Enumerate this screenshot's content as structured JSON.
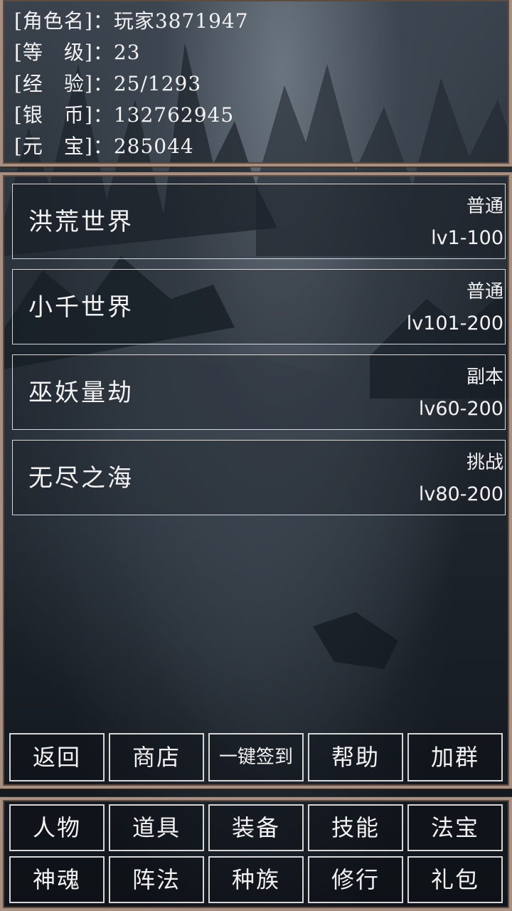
{
  "stats": [
    {
      "label": "[角色名]：",
      "value": "玩家3871947"
    },
    {
      "label": "[等　级]：",
      "value": "23"
    },
    {
      "label": "[经　验]：",
      "value": "25/1293"
    },
    {
      "label": "[银　币]：",
      "value": "132762945"
    },
    {
      "label": "[元　宝]：",
      "value": "285044"
    }
  ],
  "maps": [
    {
      "name": "洪荒世界",
      "type": "普通",
      "level": "lv1-100"
    },
    {
      "name": "小千世界",
      "type": "普通",
      "level": "lv101-200"
    },
    {
      "name": "巫妖量劫",
      "type": "副本",
      "level": "lv60-200"
    },
    {
      "name": "无尽之海",
      "type": "挑战",
      "level": "lv80-200"
    }
  ],
  "actions": [
    "返回",
    "商店",
    "一键签到",
    "帮助",
    "加群"
  ],
  "nav": [
    [
      "人物",
      "道具",
      "装备",
      "技能",
      "法宝"
    ],
    [
      "神魂",
      "阵法",
      "种族",
      "修行",
      "礼包"
    ]
  ],
  "colors": {
    "frame": "#a78f82",
    "border": "#d8d8d8",
    "text": "#f2f2f2"
  }
}
